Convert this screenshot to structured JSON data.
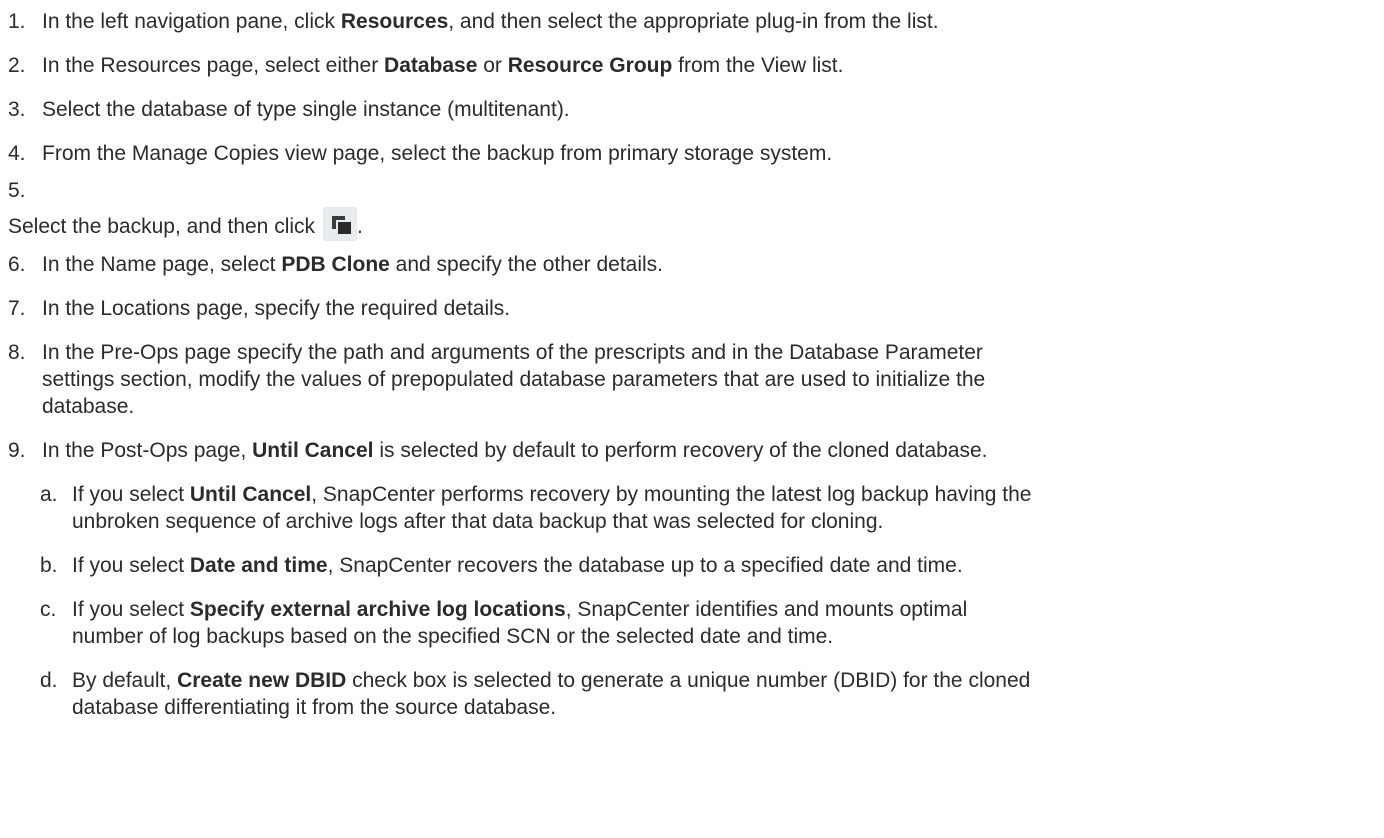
{
  "steps": [
    {
      "num": "1.",
      "parts": [
        "In the left navigation pane, click ",
        "Resources",
        ", and then select the appropriate plug-in from the list."
      ]
    },
    {
      "num": "2.",
      "parts": [
        "In the Resources page, select either ",
        "Database",
        " or ",
        "Resource Group",
        " from the View list."
      ]
    },
    {
      "num": "3.",
      "text": "Select the database of type single instance (multitenant)."
    },
    {
      "num": "4.",
      "text": "From the Manage Copies view page, select the backup from primary storage system."
    },
    {
      "num": "5.",
      "text": "Select the backup, and then click",
      "trail": ".",
      "icon": "clone-icon"
    },
    {
      "num": "6.",
      "parts": [
        "In the Name page, select ",
        "PDB Clone",
        " and specify the other details."
      ]
    },
    {
      "num": "7.",
      "text": "In the Locations page, specify the required details."
    },
    {
      "num": "8.",
      "lines": [
        "In the Pre-Ops page specify the path and arguments of the prescripts and in the Database Parameter",
        "settings section, modify the values of prepopulated database parameters that are used to initialize the",
        "database."
      ]
    },
    {
      "num": "9.",
      "parts": [
        "In the Post-Ops page, ",
        "Until Cancel",
        " is selected by default to perform recovery of the cloned database."
      ]
    }
  ],
  "substeps": [
    {
      "num": "a.",
      "parts": [
        "If you select ",
        "Until Cancel",
        ", SnapCenter performs recovery by mounting the latest log backup having the"
      ],
      "line2": "unbroken sequence of archive logs after that data backup that was selected for cloning."
    },
    {
      "num": "b.",
      "parts": [
        "If you select ",
        "Date and time",
        ", SnapCenter recovers the database up to a specified date and time."
      ]
    },
    {
      "num": "c.",
      "parts": [
        "If you select ",
        "Specify external archive log locations",
        ", SnapCenter identifies and mounts optimal"
      ],
      "line2": "number of log backups based on the specified SCN or the selected date and time."
    },
    {
      "num": "d.",
      "parts": [
        "By default, ",
        "Create new DBID",
        " check box is selected to generate a unique number (DBID) for the cloned"
      ],
      "line2": "database differentiating it from the source database."
    }
  ]
}
